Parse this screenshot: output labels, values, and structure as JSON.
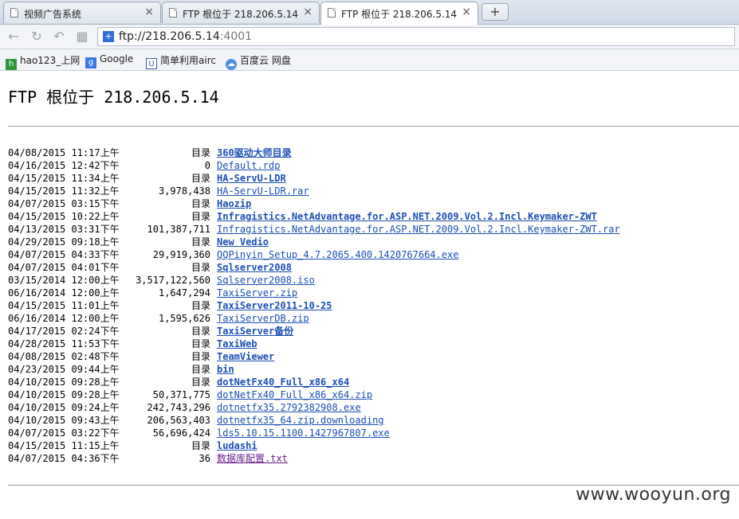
{
  "tabs": [
    {
      "label": "视频广告系统",
      "active": false
    },
    {
      "label": "FTP 根位于 218.206.5.14",
      "active": false
    },
    {
      "label": "FTP 根位于 218.206.5.14",
      "active": true
    }
  ],
  "newtab_label": "+",
  "tab_close": "×",
  "nav": {
    "url_main": "ftp://218.206.5.14",
    "url_port": ":4001"
  },
  "bookmarks": [
    {
      "label": "hao123_上网",
      "icon": "hao123-icon"
    },
    {
      "label": "Google",
      "icon": "google-icon"
    },
    {
      "label": "简单利用airc",
      "icon": "shield-icon"
    },
    {
      "label": "百度云 网盘",
      "icon": "baidu-cloud-icon"
    }
  ],
  "page": {
    "title": "FTP 根位于 218.206.5.14",
    "dir_label": "目录"
  },
  "entries": [
    {
      "date": "04/08/2015 11:17上午",
      "size": "",
      "is_dir": true,
      "name": "360驱动大师目录"
    },
    {
      "date": "04/16/2015 12:42下午",
      "size": "0",
      "is_dir": false,
      "name": "Default.rdp"
    },
    {
      "date": "04/15/2015 11:34上午",
      "size": "",
      "is_dir": true,
      "name": "HA-ServU-LDR"
    },
    {
      "date": "04/15/2015 11:32上午",
      "size": "3,978,438",
      "is_dir": false,
      "name": "HA-ServU-LDR.rar"
    },
    {
      "date": "04/07/2015 03:15下午",
      "size": "",
      "is_dir": true,
      "name": "Haozip"
    },
    {
      "date": "04/15/2015 10:22上午",
      "size": "",
      "is_dir": true,
      "name": "Infragistics.NetAdvantage.for.ASP.NET.2009.Vol.2.Incl.Keymaker-ZWT"
    },
    {
      "date": "04/13/2015 03:31下午",
      "size": "101,387,711",
      "is_dir": false,
      "name": "Infragistics.NetAdvantage.for.ASP.NET.2009.Vol.2.Incl.Keymaker-ZWT.rar"
    },
    {
      "date": "04/29/2015 09:18上午",
      "size": "",
      "is_dir": true,
      "name": "New Vedio"
    },
    {
      "date": "04/07/2015 04:33下午",
      "size": "29,919,360",
      "is_dir": false,
      "name": "QQPinyin_Setup_4.7.2065.400.1420767664.exe"
    },
    {
      "date": "04/07/2015 04:01下午",
      "size": "",
      "is_dir": true,
      "name": "Sqlserver2008"
    },
    {
      "date": "03/15/2014 12:00上午",
      "size": "3,517,122,560",
      "is_dir": false,
      "name": "Sqlserver2008.iso"
    },
    {
      "date": "06/16/2014 12:00上午",
      "size": "1,647,294",
      "is_dir": false,
      "name": "TaxiServer.zip"
    },
    {
      "date": "04/15/2015 11:01上午",
      "size": "",
      "is_dir": true,
      "name": "TaxiServer2011-10-25"
    },
    {
      "date": "06/16/2014 12:00上午",
      "size": "1,595,626",
      "is_dir": false,
      "name": "TaxiServerDB.zip"
    },
    {
      "date": "04/17/2015 02:24下午",
      "size": "",
      "is_dir": true,
      "name": "TaxiServer备份"
    },
    {
      "date": "04/28/2015 11:53下午",
      "size": "",
      "is_dir": true,
      "name": "TaxiWeb"
    },
    {
      "date": "04/08/2015 02:48下午",
      "size": "",
      "is_dir": true,
      "name": "TeamViewer"
    },
    {
      "date": "04/23/2015 09:44上午",
      "size": "",
      "is_dir": true,
      "name": "bin"
    },
    {
      "date": "04/10/2015 09:28上午",
      "size": "",
      "is_dir": true,
      "name": "dotNetFx40_Full_x86_x64"
    },
    {
      "date": "04/10/2015 09:28上午",
      "size": "50,371,775",
      "is_dir": false,
      "name": "dotNetFx40_Full_x86_x64.zip"
    },
    {
      "date": "04/10/2015 09:24上午",
      "size": "242,743,296",
      "is_dir": false,
      "name": "dotnetfx35.2792382908.exe"
    },
    {
      "date": "04/10/2015 09:43上午",
      "size": "206,563,403",
      "is_dir": false,
      "name": "dotnetfx35_64.zip.downloading"
    },
    {
      "date": "04/07/2015 03:22下午",
      "size": "56,696,424",
      "is_dir": false,
      "name": "lds5.10.15.1100.1427967807.exe"
    },
    {
      "date": "04/15/2015 11:15上午",
      "size": "",
      "is_dir": true,
      "name": "ludashi"
    },
    {
      "date": "04/07/2015 04:36下午",
      "size": "36",
      "is_dir": false,
      "name": "数据库配置.txt",
      "visited": true
    }
  ],
  "watermark": "www.wooyun.org"
}
